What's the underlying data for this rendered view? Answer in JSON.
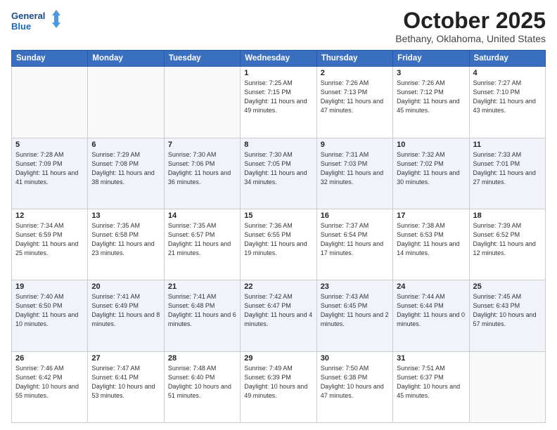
{
  "header": {
    "logo_line1": "General",
    "logo_line2": "Blue",
    "month": "October 2025",
    "location": "Bethany, Oklahoma, United States"
  },
  "days_of_week": [
    "Sunday",
    "Monday",
    "Tuesday",
    "Wednesday",
    "Thursday",
    "Friday",
    "Saturday"
  ],
  "weeks": [
    [
      {
        "day": "",
        "info": ""
      },
      {
        "day": "",
        "info": ""
      },
      {
        "day": "",
        "info": ""
      },
      {
        "day": "1",
        "info": "Sunrise: 7:25 AM\nSunset: 7:15 PM\nDaylight: 11 hours and 49 minutes."
      },
      {
        "day": "2",
        "info": "Sunrise: 7:26 AM\nSunset: 7:13 PM\nDaylight: 11 hours and 47 minutes."
      },
      {
        "day": "3",
        "info": "Sunrise: 7:26 AM\nSunset: 7:12 PM\nDaylight: 11 hours and 45 minutes."
      },
      {
        "day": "4",
        "info": "Sunrise: 7:27 AM\nSunset: 7:10 PM\nDaylight: 11 hours and 43 minutes."
      }
    ],
    [
      {
        "day": "5",
        "info": "Sunrise: 7:28 AM\nSunset: 7:09 PM\nDaylight: 11 hours and 41 minutes."
      },
      {
        "day": "6",
        "info": "Sunrise: 7:29 AM\nSunset: 7:08 PM\nDaylight: 11 hours and 38 minutes."
      },
      {
        "day": "7",
        "info": "Sunrise: 7:30 AM\nSunset: 7:06 PM\nDaylight: 11 hours and 36 minutes."
      },
      {
        "day": "8",
        "info": "Sunrise: 7:30 AM\nSunset: 7:05 PM\nDaylight: 11 hours and 34 minutes."
      },
      {
        "day": "9",
        "info": "Sunrise: 7:31 AM\nSunset: 7:03 PM\nDaylight: 11 hours and 32 minutes."
      },
      {
        "day": "10",
        "info": "Sunrise: 7:32 AM\nSunset: 7:02 PM\nDaylight: 11 hours and 30 minutes."
      },
      {
        "day": "11",
        "info": "Sunrise: 7:33 AM\nSunset: 7:01 PM\nDaylight: 11 hours and 27 minutes."
      }
    ],
    [
      {
        "day": "12",
        "info": "Sunrise: 7:34 AM\nSunset: 6:59 PM\nDaylight: 11 hours and 25 minutes."
      },
      {
        "day": "13",
        "info": "Sunrise: 7:35 AM\nSunset: 6:58 PM\nDaylight: 11 hours and 23 minutes."
      },
      {
        "day": "14",
        "info": "Sunrise: 7:35 AM\nSunset: 6:57 PM\nDaylight: 11 hours and 21 minutes."
      },
      {
        "day": "15",
        "info": "Sunrise: 7:36 AM\nSunset: 6:55 PM\nDaylight: 11 hours and 19 minutes."
      },
      {
        "day": "16",
        "info": "Sunrise: 7:37 AM\nSunset: 6:54 PM\nDaylight: 11 hours and 17 minutes."
      },
      {
        "day": "17",
        "info": "Sunrise: 7:38 AM\nSunset: 6:53 PM\nDaylight: 11 hours and 14 minutes."
      },
      {
        "day": "18",
        "info": "Sunrise: 7:39 AM\nSunset: 6:52 PM\nDaylight: 11 hours and 12 minutes."
      }
    ],
    [
      {
        "day": "19",
        "info": "Sunrise: 7:40 AM\nSunset: 6:50 PM\nDaylight: 11 hours and 10 minutes."
      },
      {
        "day": "20",
        "info": "Sunrise: 7:41 AM\nSunset: 6:49 PM\nDaylight: 11 hours and 8 minutes."
      },
      {
        "day": "21",
        "info": "Sunrise: 7:41 AM\nSunset: 6:48 PM\nDaylight: 11 hours and 6 minutes."
      },
      {
        "day": "22",
        "info": "Sunrise: 7:42 AM\nSunset: 6:47 PM\nDaylight: 11 hours and 4 minutes."
      },
      {
        "day": "23",
        "info": "Sunrise: 7:43 AM\nSunset: 6:45 PM\nDaylight: 11 hours and 2 minutes."
      },
      {
        "day": "24",
        "info": "Sunrise: 7:44 AM\nSunset: 6:44 PM\nDaylight: 11 hours and 0 minutes."
      },
      {
        "day": "25",
        "info": "Sunrise: 7:45 AM\nSunset: 6:43 PM\nDaylight: 10 hours and 57 minutes."
      }
    ],
    [
      {
        "day": "26",
        "info": "Sunrise: 7:46 AM\nSunset: 6:42 PM\nDaylight: 10 hours and 55 minutes."
      },
      {
        "day": "27",
        "info": "Sunrise: 7:47 AM\nSunset: 6:41 PM\nDaylight: 10 hours and 53 minutes."
      },
      {
        "day": "28",
        "info": "Sunrise: 7:48 AM\nSunset: 6:40 PM\nDaylight: 10 hours and 51 minutes."
      },
      {
        "day": "29",
        "info": "Sunrise: 7:49 AM\nSunset: 6:39 PM\nDaylight: 10 hours and 49 minutes."
      },
      {
        "day": "30",
        "info": "Sunrise: 7:50 AM\nSunset: 6:38 PM\nDaylight: 10 hours and 47 minutes."
      },
      {
        "day": "31",
        "info": "Sunrise: 7:51 AM\nSunset: 6:37 PM\nDaylight: 10 hours and 45 minutes."
      },
      {
        "day": "",
        "info": ""
      }
    ]
  ]
}
